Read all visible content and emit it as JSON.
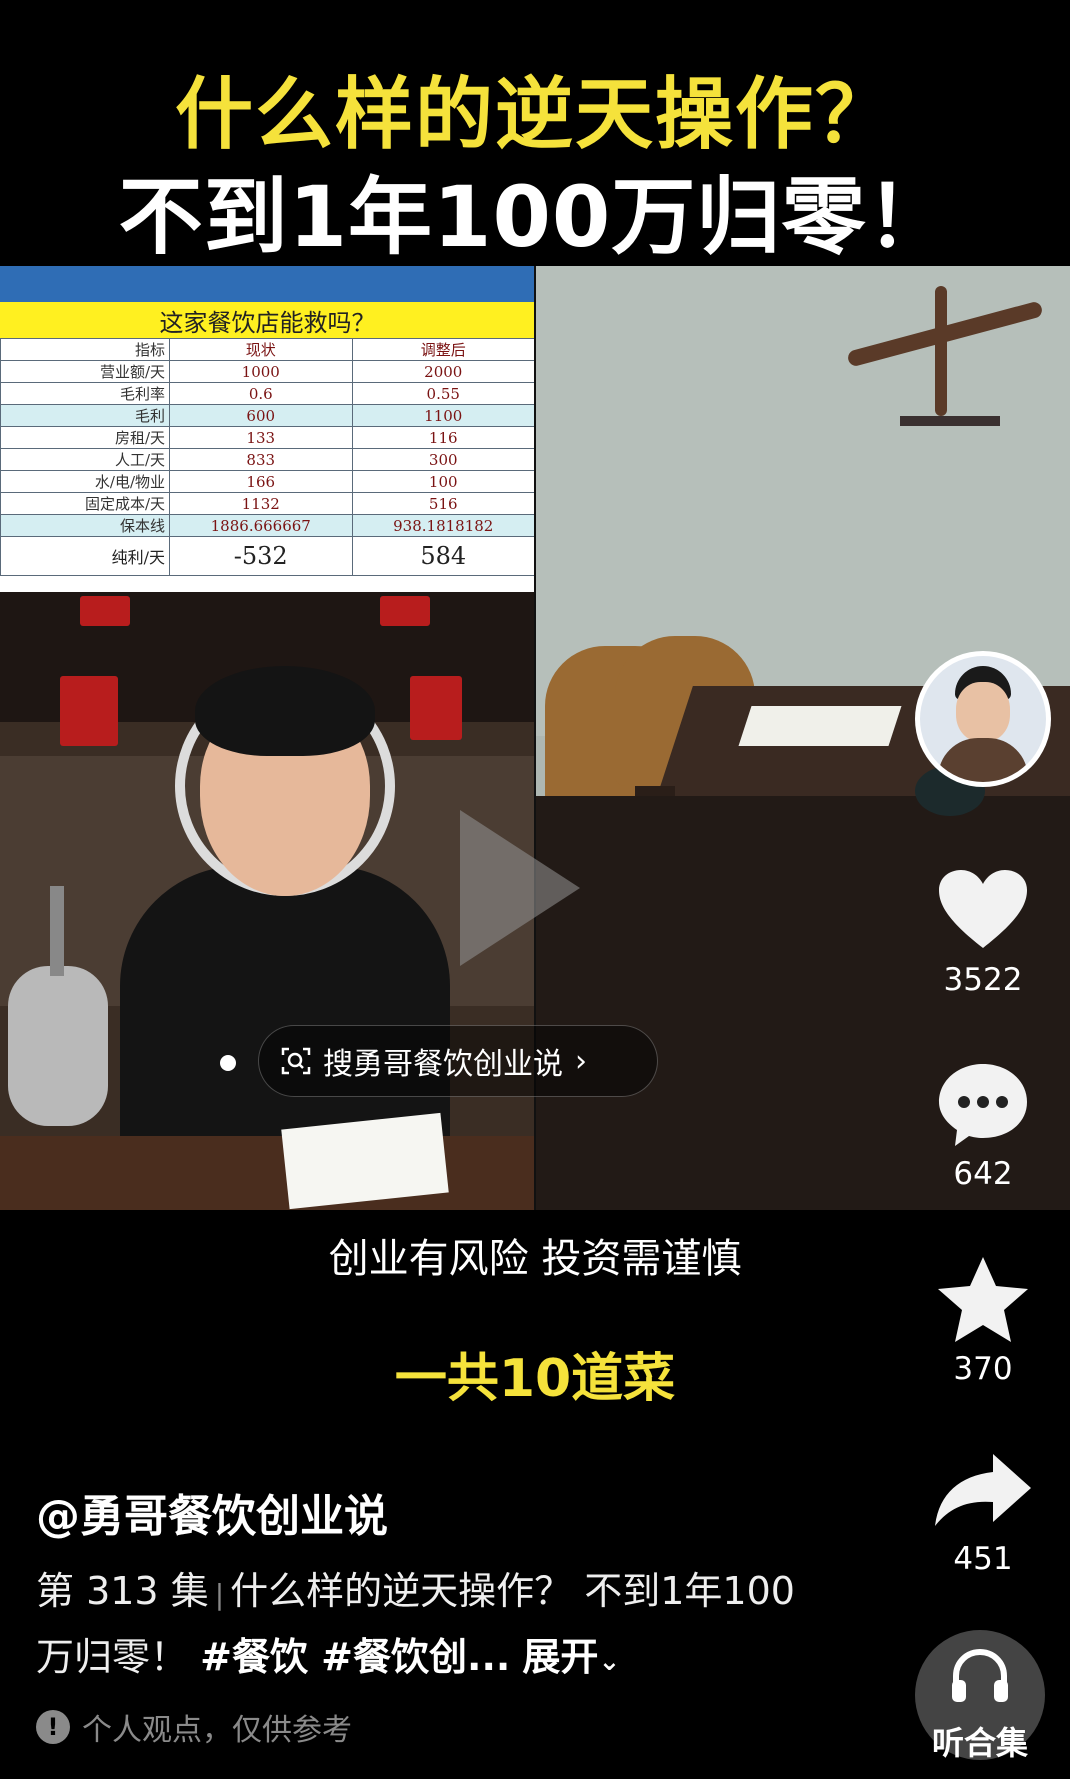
{
  "overlay_title": {
    "line1": "什么样的逆天操作？",
    "line2": "不到1年100万归零！"
  },
  "sheet": {
    "title": "这家餐饮店能救吗？",
    "headers": [
      "指标",
      "现状",
      "调整后"
    ],
    "rows": [
      [
        "营业额/天",
        "1000",
        "2000"
      ],
      [
        "毛利率",
        "0.6",
        "0.55"
      ],
      [
        "毛利",
        "600",
        "1100"
      ],
      [
        "房租/天",
        "133",
        "116"
      ],
      [
        "人工/天",
        "833",
        "300"
      ],
      [
        "水/电/物业",
        "166",
        "100"
      ],
      [
        "固定成本/天",
        "1132",
        "516"
      ],
      [
        "保本线",
        "1886.666667",
        "938.1818182"
      ],
      [
        "纯利/天",
        "-532",
        "584"
      ]
    ]
  },
  "search_pill": {
    "label": "搜勇哥餐饮创业说"
  },
  "rail": {
    "likes": "3522",
    "comments": "642",
    "favorites": "370",
    "shares": "451",
    "listen": "听合集"
  },
  "captions": {
    "line1": "创业有风险 投资需谨慎",
    "line2": "一共10道菜"
  },
  "post": {
    "author": "@勇哥餐饮创业说",
    "episode": "第 313 集",
    "text": "什么样的逆天操作？ 不到1年100万归零！",
    "tags": "#餐饮 #餐饮创...",
    "expand": "展开",
    "notice": "个人观点，仅供参考"
  },
  "colors": {
    "title_yellow": "#f5e23b",
    "sheet_yellow": "#fff020",
    "sheet_blue": "#2f6db5"
  }
}
